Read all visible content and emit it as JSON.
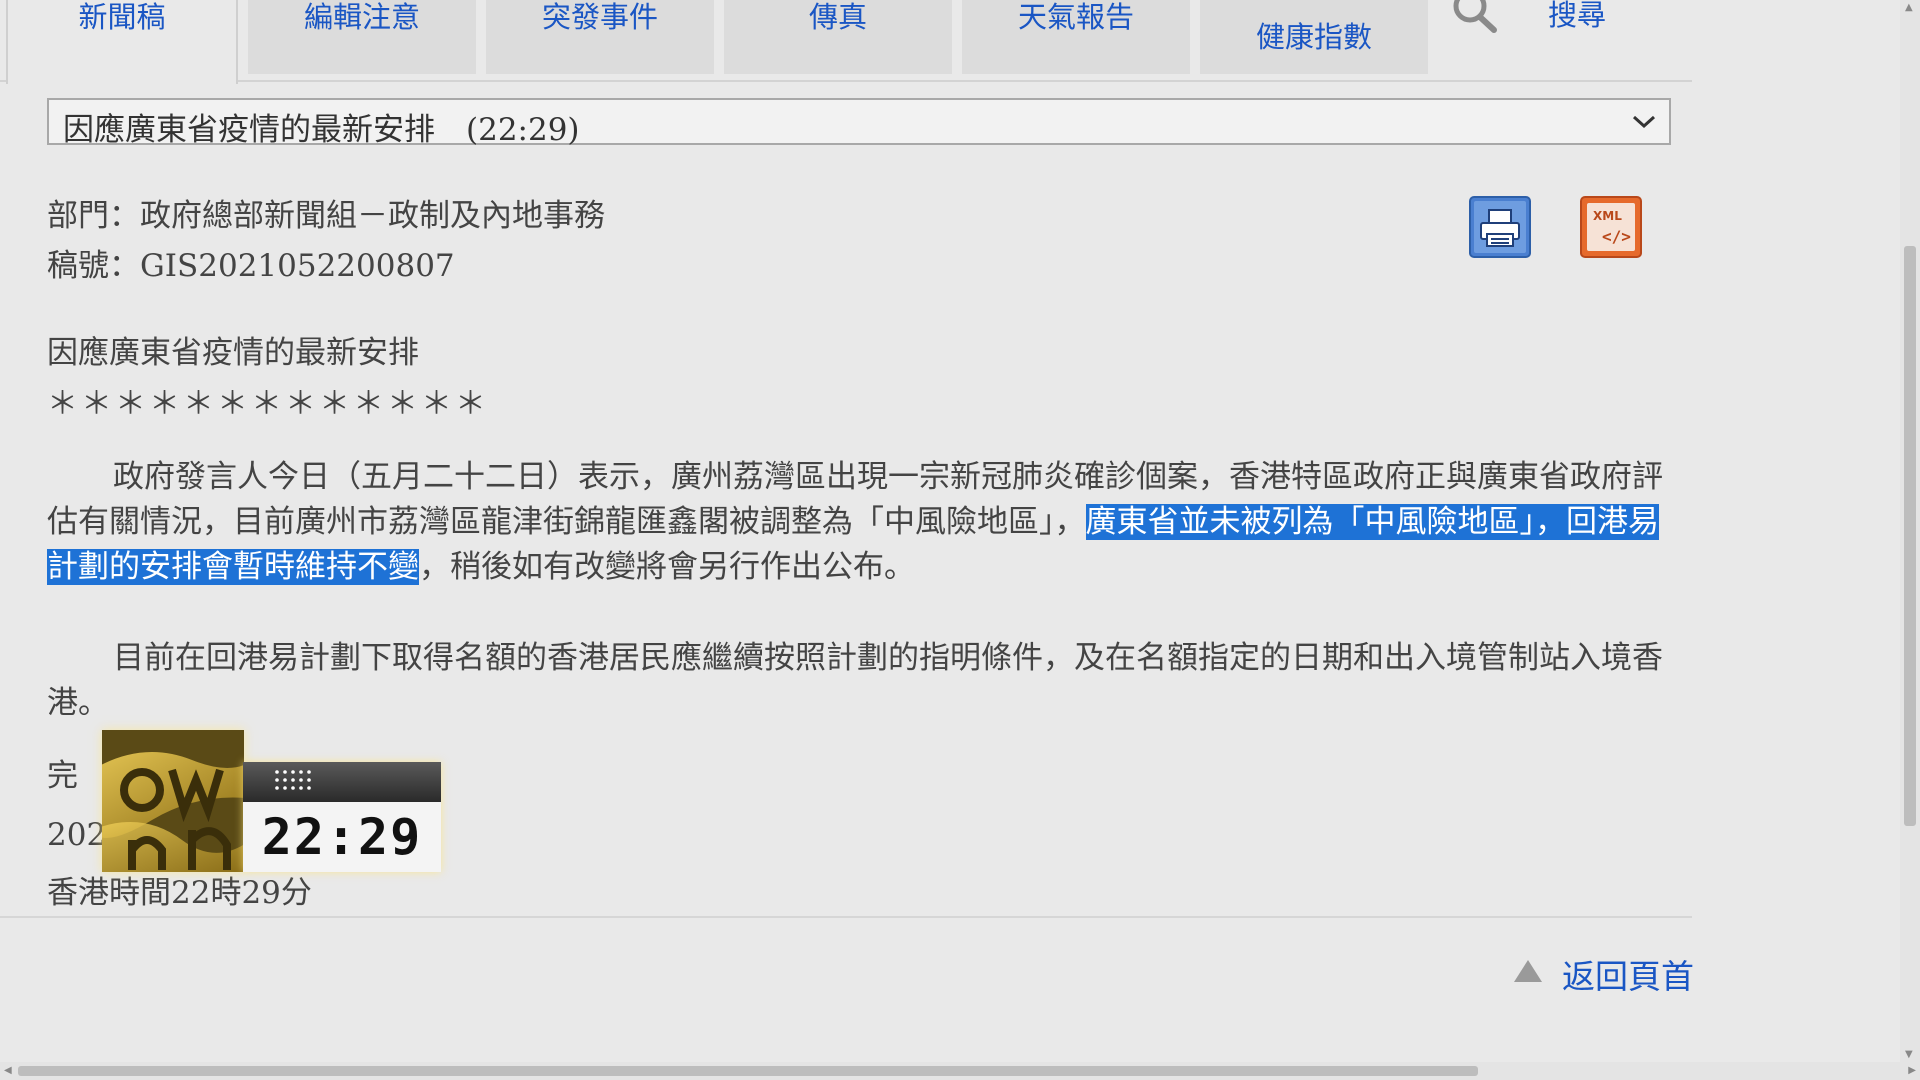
{
  "tabs": [
    {
      "label": "新聞稿",
      "active": true
    },
    {
      "label": "編輯注意"
    },
    {
      "label": "突發事件"
    },
    {
      "label": "傳真"
    },
    {
      "label": "天氣報告"
    },
    {
      "label": "健康指數"
    }
  ],
  "search": {
    "label": "搜尋",
    "icon": "search-icon"
  },
  "release_select": {
    "value": "因應廣東省疫情的最新安排　(22:29)"
  },
  "meta": {
    "department": "部門：政府總部新聞組－政制及內地事務",
    "reference": "稿號：GIS2021052200807"
  },
  "actions": {
    "print_icon": "print-icon",
    "xml_icon": "xml-icon"
  },
  "article": {
    "title": "因應廣東省疫情的最新安排",
    "stars": "＊＊＊＊＊＊＊＊＊＊＊＊＊",
    "para1_before": "政府發言人今日（五月二十二日）表示，廣州荔灣區出現一宗新冠肺炎確診個案，香港特區政府正與廣東省政府評估有關情況，目前廣州市荔灣區龍津街錦龍匯鑫閣被調整為「中風險地區」，",
    "para1_highlight": "廣東省並未被列為「中風險地區」，回港易計劃的安排會暫時維持不變",
    "para1_after": "，稍後如有改變將會另行作出公布。",
    "para2": "目前在回港易計劃下取得名額的香港居民應繼續按照計劃的指明條件，及在名額指定的日期和出入境管制站入境香港。",
    "end_mark": "完",
    "date_partial": "202",
    "time_line": "香港時間22時29分"
  },
  "overlay": {
    "clock": "22:29"
  },
  "footer": {
    "back_to_top": "返回頁首"
  },
  "colors": {
    "link": "#1a56c4",
    "highlight": "#1e72d6",
    "background": "#e9e9e9"
  }
}
